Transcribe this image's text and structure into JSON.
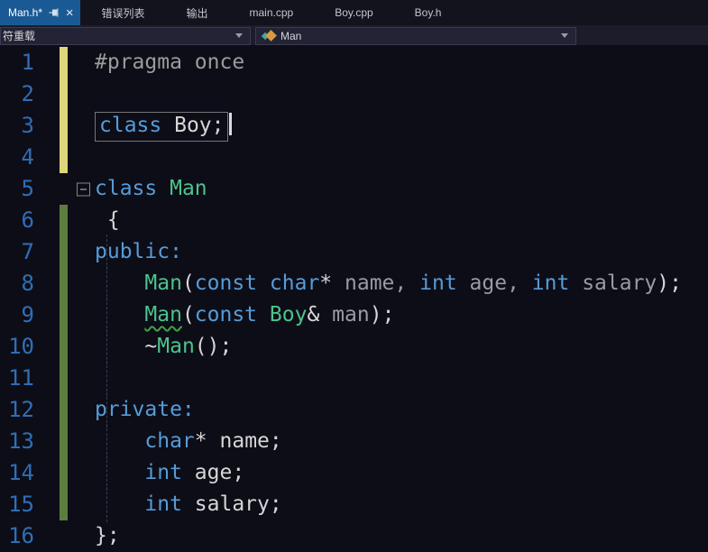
{
  "colors": {
    "editor_bg": "#0d0d18",
    "active_tab_bg": "#1a5a94",
    "keyword": "#569cd6",
    "type_name": "#4cc38a",
    "parameter": "#9a9aa2",
    "directive_gray": "#9b9b9b",
    "line_number": "#2f6fb4",
    "modified_unsaved_bar": "#ded57c",
    "modified_saved_bar": "#5d7d3e",
    "squiggle": "#3ea63e"
  },
  "tab_bar": {
    "active_tab": {
      "label": "Man.h*"
    },
    "tabs": [
      "错误列表",
      "输出",
      "main.cpp",
      "Boy.cpp",
      "Boy.h"
    ]
  },
  "navbar": {
    "scope_dropdown": "符重载",
    "member_dropdown": "Man"
  },
  "editor": {
    "cursor_line": 3,
    "lines": [
      {
        "num": "1",
        "bar": "yellow",
        "tokens": [
          {
            "t": "#pragma once",
            "c": "dir"
          }
        ]
      },
      {
        "num": "2",
        "bar": "yellow",
        "tokens": []
      },
      {
        "num": "3",
        "bar": "yellow",
        "boxed": true,
        "caret": true,
        "tokens": [
          {
            "t": "class",
            "c": "kw"
          },
          {
            "t": " ",
            "c": "sp"
          },
          {
            "t": "Boy;",
            "c": "id"
          }
        ]
      },
      {
        "num": "4",
        "bar": "yellow",
        "tokens": []
      },
      {
        "num": "5",
        "fold": true,
        "tokens": [
          {
            "t": "class",
            "c": "kw"
          },
          {
            "t": " ",
            "c": "sp"
          },
          {
            "t": "Man",
            "c": "type"
          }
        ]
      },
      {
        "num": "6",
        "bar": "green",
        "tokens": [
          {
            "t": " {",
            "c": "punc"
          }
        ]
      },
      {
        "num": "7",
        "bar": "green",
        "guide": true,
        "tokens": [
          {
            "t": "public:",
            "c": "kw"
          }
        ]
      },
      {
        "num": "8",
        "bar": "green",
        "guide": true,
        "tokens": [
          {
            "t": "    ",
            "c": "sp"
          },
          {
            "t": "Man",
            "c": "type"
          },
          {
            "t": "(",
            "c": "punc"
          },
          {
            "t": "const",
            "c": "kw"
          },
          {
            "t": " ",
            "c": "sp"
          },
          {
            "t": "char",
            "c": "kw"
          },
          {
            "t": "*",
            "c": "punc"
          },
          {
            "t": " ",
            "c": "sp"
          },
          {
            "t": "name,",
            "c": "param"
          },
          {
            "t": " ",
            "c": "sp"
          },
          {
            "t": "int",
            "c": "kw"
          },
          {
            "t": " ",
            "c": "sp"
          },
          {
            "t": "age,",
            "c": "param"
          },
          {
            "t": " ",
            "c": "sp"
          },
          {
            "t": "int",
            "c": "kw"
          },
          {
            "t": " ",
            "c": "sp"
          },
          {
            "t": "salary",
            "c": "param"
          },
          {
            "t": ");",
            "c": "punc"
          }
        ]
      },
      {
        "num": "9",
        "bar": "green",
        "guide": true,
        "tokens": [
          {
            "t": "    ",
            "c": "sp"
          },
          {
            "t": "Man",
            "c": "type",
            "squiggle": true
          },
          {
            "t": "(",
            "c": "punc"
          },
          {
            "t": "const",
            "c": "kw"
          },
          {
            "t": " ",
            "c": "sp"
          },
          {
            "t": "Boy",
            "c": "type"
          },
          {
            "t": "&",
            "c": "punc"
          },
          {
            "t": " ",
            "c": "sp"
          },
          {
            "t": "man",
            "c": "param"
          },
          {
            "t": ");",
            "c": "punc"
          }
        ]
      },
      {
        "num": "10",
        "bar": "green",
        "guide": true,
        "tokens": [
          {
            "t": "    ",
            "c": "sp"
          },
          {
            "t": "~",
            "c": "punc"
          },
          {
            "t": "Man",
            "c": "type"
          },
          {
            "t": "();",
            "c": "punc"
          }
        ]
      },
      {
        "num": "11",
        "bar": "green",
        "guide": true,
        "tokens": []
      },
      {
        "num": "12",
        "bar": "green",
        "guide": true,
        "tokens": [
          {
            "t": "private:",
            "c": "kw"
          }
        ]
      },
      {
        "num": "13",
        "bar": "green",
        "guide": true,
        "tokens": [
          {
            "t": "    ",
            "c": "sp"
          },
          {
            "t": "char",
            "c": "kw"
          },
          {
            "t": "*",
            "c": "punc"
          },
          {
            "t": " ",
            "c": "sp"
          },
          {
            "t": "name;",
            "c": "id"
          }
        ]
      },
      {
        "num": "14",
        "bar": "green",
        "guide": true,
        "tokens": [
          {
            "t": "    ",
            "c": "sp"
          },
          {
            "t": "int",
            "c": "kw"
          },
          {
            "t": " ",
            "c": "sp"
          },
          {
            "t": "age;",
            "c": "id"
          }
        ]
      },
      {
        "num": "15",
        "bar": "green",
        "guide": true,
        "tokens": [
          {
            "t": "    ",
            "c": "sp"
          },
          {
            "t": "int",
            "c": "kw"
          },
          {
            "t": " ",
            "c": "sp"
          },
          {
            "t": "salary;",
            "c": "id"
          }
        ]
      },
      {
        "num": "16",
        "tokens": [
          {
            "t": "};",
            "c": "punc"
          }
        ]
      }
    ]
  }
}
